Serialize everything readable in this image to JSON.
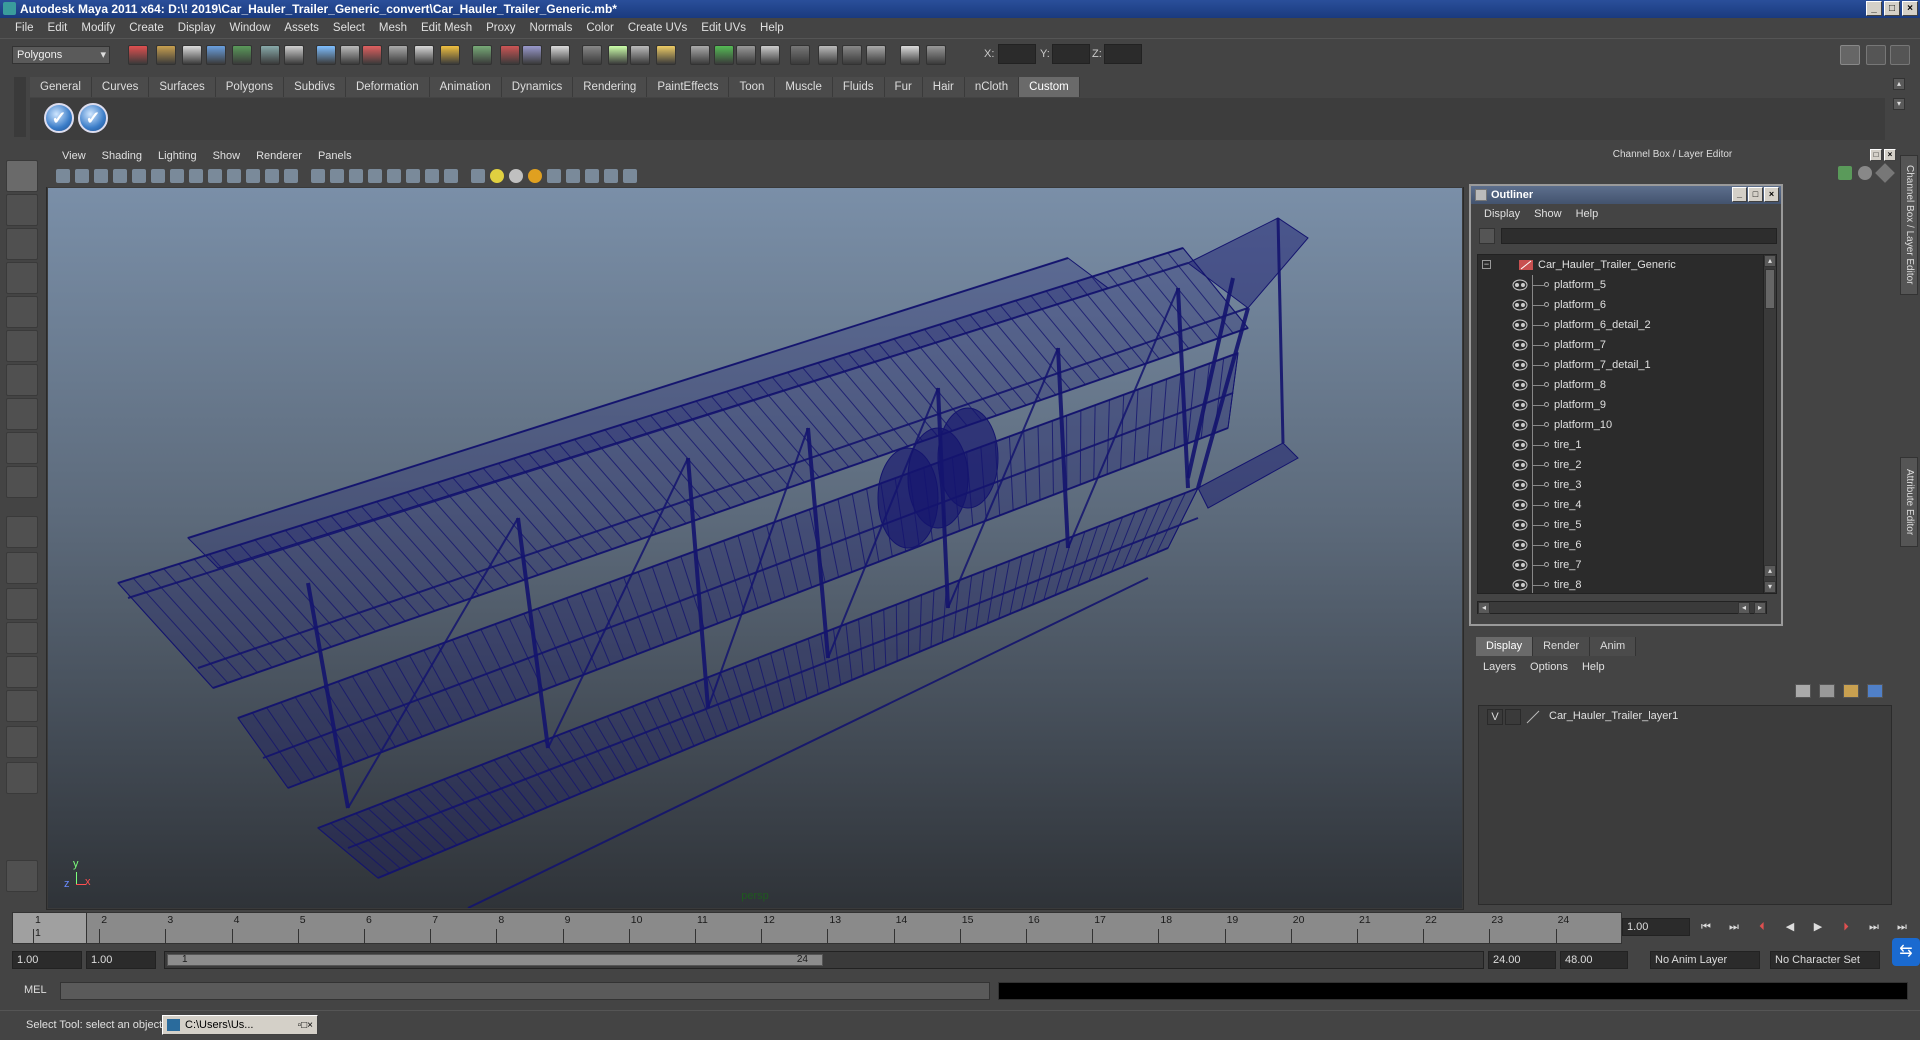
{
  "window": {
    "title": "Autodesk Maya 2011 x64: D:\\! 2019\\Car_Hauler_Trailer_Generic_convert\\Car_Hauler_Trailer_Generic.mb*"
  },
  "menubar": [
    "File",
    "Edit",
    "Modify",
    "Create",
    "Display",
    "Window",
    "Assets",
    "Select",
    "Mesh",
    "Edit Mesh",
    "Proxy",
    "Normals",
    "Color",
    "Create UVs",
    "Edit UVs",
    "Help"
  ],
  "statusline": {
    "mode_select": "Polygons",
    "x_label": "X:",
    "y_label": "Y:",
    "z_label": "Z:"
  },
  "shelf": {
    "tabs": [
      "General",
      "Curves",
      "Surfaces",
      "Polygons",
      "Subdivs",
      "Deformation",
      "Animation",
      "Dynamics",
      "Rendering",
      "PaintEffects",
      "Toon",
      "Muscle",
      "Fluids",
      "Fur",
      "Hair",
      "nCloth",
      "Custom"
    ],
    "active_tab": "Custom"
  },
  "viewport": {
    "menu": [
      "View",
      "Shading",
      "Lighting",
      "Show",
      "Renderer",
      "Panels"
    ],
    "camera_label": "persp",
    "wire_color": "#14146e",
    "axis": {
      "y": "y",
      "x": "x",
      "z": "z"
    }
  },
  "channel_box": {
    "title": "Channel Box / Layer Editor",
    "side_tabs": [
      "Channel Box / Layer Editor",
      "Attribute Editor"
    ]
  },
  "outliner": {
    "title": "Outliner",
    "menu": [
      "Display",
      "Show",
      "Help"
    ],
    "root": "Car_Hauler_Trailer_Generic",
    "items": [
      "platform_5",
      "platform_6",
      "platform_6_detail_2",
      "platform_7",
      "platform_7_detail_1",
      "platform_8",
      "platform_9",
      "platform_10",
      "tire_1",
      "tire_2",
      "tire_3",
      "tire_4",
      "tire_5",
      "tire_6",
      "tire_7",
      "tire_8"
    ]
  },
  "layer_editor": {
    "tabs": [
      "Display",
      "Render",
      "Anim"
    ],
    "active_tab": "Display",
    "menu": [
      "Layers",
      "Options",
      "Help"
    ],
    "layers": [
      {
        "visible": "V",
        "name": "Car_Hauler_Trailer_layer1"
      }
    ]
  },
  "timeline": {
    "labels": [
      "1",
      "2",
      "3",
      "4",
      "5",
      "6",
      "7",
      "8",
      "9",
      "10",
      "11",
      "12",
      "13",
      "14",
      "15",
      "16",
      "17",
      "18",
      "19",
      "20",
      "21",
      "22",
      "23",
      "24"
    ],
    "current_frame": "1",
    "current_time_field": "1.00"
  },
  "range": {
    "start_time": "1.00",
    "playback_start": "1.00",
    "slider_start": "1",
    "slider_end": "24",
    "playback_end": "24.00",
    "end_time": "48.00",
    "anim_layer": "No Anim Layer",
    "character_set": "No Character Set"
  },
  "command_line": {
    "label": "MEL"
  },
  "help_line": {
    "text": "Select Tool: select an object",
    "task_button": "C:\\Users\\Us..."
  }
}
